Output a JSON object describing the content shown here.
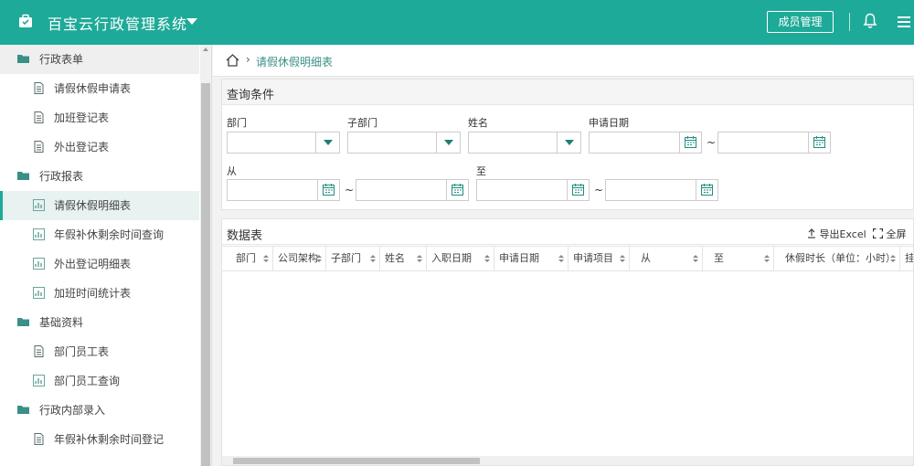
{
  "app": {
    "title": "百宝云行政管理系统",
    "member_button": "成员管理"
  },
  "breadcrumb": {
    "current": "请假休假明细表"
  },
  "sidebar": {
    "items": [
      {
        "label": "行政表单",
        "type": "group"
      },
      {
        "label": "请假休假申请表",
        "type": "child-form"
      },
      {
        "label": "加班登记表",
        "type": "child-form"
      },
      {
        "label": "外出登记表",
        "type": "child-form"
      },
      {
        "label": "行政报表",
        "type": "group"
      },
      {
        "label": "请假休假明细表",
        "type": "child-report"
      },
      {
        "label": "年假补休剩余时间查询",
        "type": "child-report"
      },
      {
        "label": "外出登记明细表",
        "type": "child-report"
      },
      {
        "label": "加班时间统计表",
        "type": "child-report"
      },
      {
        "label": "基础资料",
        "type": "group"
      },
      {
        "label": "部门员工表",
        "type": "child-form"
      },
      {
        "label": "部门员工查询",
        "type": "child-report"
      },
      {
        "label": "行政内部录入",
        "type": "group"
      },
      {
        "label": "年假补休剩余时间登记",
        "type": "child-form"
      }
    ]
  },
  "query": {
    "title": "查询条件",
    "dept_label": "部门",
    "subdept_label": "子部门",
    "name_label": "姓名",
    "apply_date_label": "申请日期",
    "from_label": "从",
    "to_label": "至",
    "range_sep": "~"
  },
  "table": {
    "title": "数据表",
    "export_label": "导出Excel",
    "fullscreen_label": "全屏",
    "columns": [
      "部门",
      "公司架构",
      "子部门",
      "姓名",
      "入职日期",
      "申请日期",
      "申请项目",
      "从",
      "至",
      "休假时长（单位：小时）",
      "挂"
    ]
  },
  "colors": {
    "brand": "#1eaa98",
    "active_bg": "#e8f2f0"
  }
}
